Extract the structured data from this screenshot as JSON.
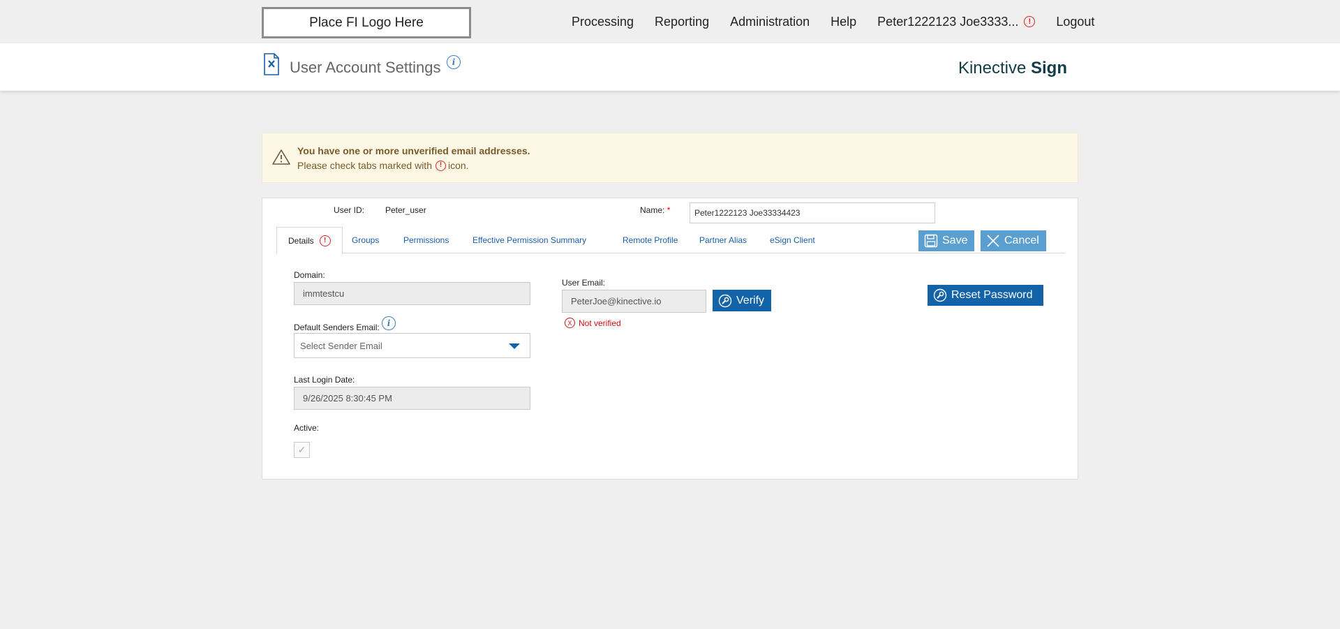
{
  "header": {
    "logo_placeholder": "Place FI Logo Here",
    "nav": [
      "Processing",
      "Reporting",
      "Administration",
      "Help"
    ],
    "user_name": "Peter1222123 Joe3333...",
    "logout": "Logout",
    "warning_glyph": "!"
  },
  "page": {
    "title": "User Account Settings",
    "info_glyph": "i",
    "brand_light": "Kinective",
    "brand_bold": "Sign"
  },
  "alert": {
    "title": "You have one or more unverified email addresses.",
    "text_before": "Please check tabs marked with",
    "text_after": "icon."
  },
  "form": {
    "user_id_label": "User ID:",
    "user_id_value": "Peter_user",
    "name_label": "Name:",
    "required_mark": "*",
    "name_value": "Peter1222123 Joe33334423",
    "domain_label": "Domain:",
    "domain_value": "immtestcu",
    "default_sender_label": "Default Senders Email:",
    "default_sender_placeholder": "Select Sender Email",
    "last_login_label": "Last Login Date:",
    "last_login_value": "9/26/2025 8:30:45 PM",
    "active_label": "Active:",
    "active_checked": true,
    "user_email_label": "User Email:",
    "user_email_value": "PeterJoe@kinective.io",
    "not_verified": "Not verified",
    "not_verified_glyph": "X"
  },
  "tabs": [
    "Details",
    "Groups",
    "Permissions",
    "Effective Permission Summary",
    "Remote Profile",
    "Partner Alias",
    "eSign Client"
  ],
  "buttons": {
    "save": "Save",
    "cancel": "Cancel",
    "verify": "Verify",
    "reset_password": "Reset Password"
  },
  "colors": {
    "primary_button": "#1363a9",
    "light_button": "#5b9fd0",
    "warning_red": "#e02020",
    "alert_bg": "#fdf8e6"
  }
}
